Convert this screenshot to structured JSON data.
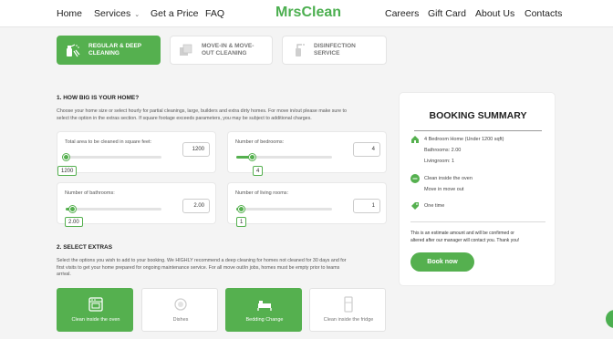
{
  "nav": {
    "home": "Home",
    "services": "Services",
    "get_price": "Get a Price",
    "faq": "FAQ",
    "logo": "MrsClean",
    "careers": "Careers",
    "gift_card": "Gift Card",
    "about": "About Us",
    "contacts": "Contacts"
  },
  "services": [
    {
      "label_1": "REGULAR & DEEP",
      "label_2": "CLEANING",
      "icon": "cleaning-spray-icon",
      "active": true
    },
    {
      "label_1": "MOVE-IN & MOVE-",
      "label_2": "OUT CLEANING",
      "icon": "moving-box-icon",
      "active": false
    },
    {
      "label_1": "DISINFECTION",
      "label_2": "SERVICE",
      "icon": "disinfection-sprayer-icon",
      "active": false
    }
  ],
  "section1": {
    "heading": "1. HOW BIG IS YOUR HOME?",
    "desc_1": "Choose your home size or select hourly for partial cleanings, large, builders and extra dirty homes. For move in/out please make sure to",
    "desc_2": "select the option in the extras section. If square footage exceeds parameters, you may be subject to additional charges."
  },
  "sliders": {
    "area": {
      "label": "Total area to be cleaned in square feet:",
      "value": "1200",
      "bubble": "1200",
      "fraction": 0.0
    },
    "bedrooms": {
      "label": "Number of bedrooms:",
      "value": "4",
      "bubble": "4",
      "fraction": 0.16
    },
    "bathrooms": {
      "label": "Number of bathrooms:",
      "value": "2.00",
      "bubble": "2.00",
      "fraction": 0.07
    },
    "living": {
      "label": "Number of living rooms:",
      "value": "1",
      "bubble": "1",
      "fraction": 0.05
    }
  },
  "section2": {
    "heading": "2. SELECT EXTRAS",
    "desc_1": "Select the options you wish to add to your booking. We HIGHLY recommend a deep cleaning for homes not cleaned for 30 days and for",
    "desc_2": "first visits to get your home prepared for ongoing maintenance service. For all move out/in jobs, homes must be empty prior to teams",
    "desc_3": "arrival."
  },
  "extras": [
    {
      "label": "Clean inside the oven",
      "icon": "oven-icon",
      "active": true
    },
    {
      "label": "Dishes",
      "icon": "dishes-icon",
      "active": false
    },
    {
      "label": "Bedding Change",
      "icon": "bed-icon",
      "active": true
    },
    {
      "label": "Clean inside the fridge",
      "icon": "fridge-icon",
      "active": false
    }
  ],
  "summary": {
    "title": "BOOKING SUMMARY",
    "home_line1": "4 Bedroom Home (Under 1200 sqft)",
    "home_line2": "Bathrooms: 2.00",
    "home_line3": "Livingroom: 1",
    "extras_line1": "Clean inside the oven",
    "extras_line2": "Move in move out",
    "frequency": "One time",
    "note_1": "This is an estimate amount and will be confirmed or",
    "note_2": "altered after our manager will contact you. Thank you!",
    "button": "Book now"
  },
  "colors": {
    "accent": "#55b04f",
    "logo": "#4caf50"
  }
}
